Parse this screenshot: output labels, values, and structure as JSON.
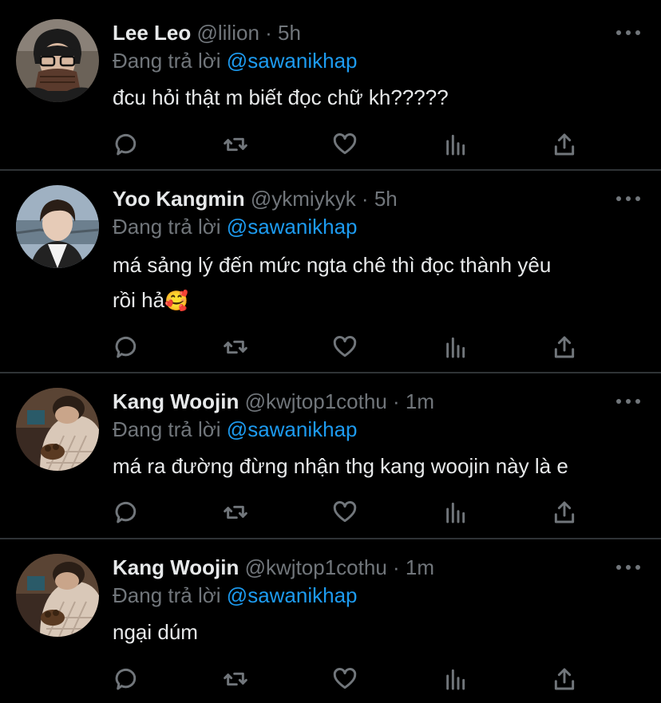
{
  "tweets": [
    {
      "name": "Lee Leo",
      "handle": "@lilion",
      "sep": "·",
      "time": "5h",
      "reply_prefix": "Đang trả lời",
      "reply_to": "@sawanikhap",
      "text_line1": "đcu hỏi thật m biết đọc chữ kh?????",
      "text_line2": ""
    },
    {
      "name": "Yoo Kangmin",
      "handle": "@ykmiykyk",
      "sep": "·",
      "time": "5h",
      "reply_prefix": "Đang trả lời",
      "reply_to": "@sawanikhap",
      "text_line1": "má sảng lý đến mức ngta chê thì đọc thành yêu",
      "text_line2": "rồi hả",
      "emoji": "🥰"
    },
    {
      "name": "Kang Woojin",
      "handle": "@kwjtop1cothu",
      "sep": "·",
      "time": "1m",
      "reply_prefix": "Đang trả lời",
      "reply_to": "@sawanikhap",
      "text_line1": "má ra đường đừng nhận thg kang woojin này là e",
      "text_line2": ""
    },
    {
      "name": "Kang Woojin",
      "handle": "@kwjtop1cothu",
      "sep": "·",
      "time": "1m",
      "reply_prefix": "Đang trả lời",
      "reply_to": "@sawanikhap",
      "text_line1": "ngại dúm",
      "text_line2": ""
    }
  ],
  "action_icons": [
    "reply-icon",
    "retweet-icon",
    "like-icon",
    "analytics-icon",
    "share-icon"
  ],
  "colors": {
    "background": "#000000",
    "text": "#e7e9ea",
    "muted": "#71767b",
    "mention": "#1d9bf0",
    "divider": "#2f3336"
  }
}
